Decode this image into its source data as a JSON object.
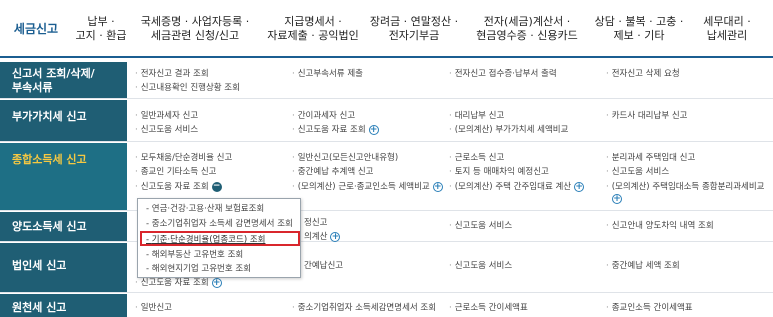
{
  "nav": {
    "tabs": [
      {
        "label": "세금신고",
        "active": true
      },
      {
        "label": "납부 ·\n고지 · 환급"
      },
      {
        "label": "국세증명 · 사업자등록 ·\n세금관련 신청/신고"
      },
      {
        "label": "지급명세서 ·\n자료제출 · 공익법인"
      },
      {
        "label": "장려금 · 연말정산 ·\n전자기부금"
      },
      {
        "label": "전자(세금)계산서 ·\n현금영수증 · 신용카드"
      },
      {
        "label": "상담 · 불복 · 고충 ·\n제보 · 기타"
      },
      {
        "label": "세무대리 ·\n납세관리"
      }
    ]
  },
  "rows": [
    {
      "category": "신고서 조회/삭제/\n부속서류",
      "links": [
        "전자신고 결과 조회",
        "신고부속서류 제출",
        "전자신고 접수증·납부서 출력",
        "전자신고 삭제 요청",
        "신고내용확인 진행상황 조회"
      ]
    },
    {
      "category": "부가가치세 신고",
      "links": [
        "일반과세자 신고",
        "간이과세자 신고",
        "대리납부 신고",
        "카드사 대리납부 신고",
        "신고도움 서비스",
        "신고도움 자료 조회",
        "(모의계산) 부가가치세 세액비교"
      ]
    },
    {
      "category": "종합소득세 신고",
      "links": [
        "모두채움/단순경비율 신고",
        "일반신고(모든신고안내유형)",
        "근로소득 신고",
        "분리과세 주택임대 신고",
        "종교인 기타소득 신고",
        "중간예납 추계액 신고",
        "토지 등 매매차익 예정신고",
        "신고도움 서비스",
        "신고도움 자료 조회",
        "(모의계산) 근로·종교인소득 세액비교",
        "(모의계산) 주택 간주임대료 계산",
        "(모의계산) 주택임대소득 종합분리과세비교"
      ]
    },
    {
      "category": "양도소득세 신고",
      "links": [
        "정신고",
        "의계산",
        "신고도움 서비스",
        "신고안내 양도차익 내역 조회"
      ]
    },
    {
      "category": "법인세 신고",
      "links": [
        "간예납신고",
        "신고도움 서비스",
        "중간예납 세액 조회",
        "신고도움 자료 조회"
      ]
    },
    {
      "category": "원천세 신고",
      "links": [
        "일반신고",
        "중소기업취업자 소득세감면명세서 조회",
        "근로소득 간이세액표",
        "종교인소득 간이세액표"
      ]
    }
  ],
  "popup": {
    "items": [
      "연금·건강·고용·산재 보험료조회",
      "중소기업취업자 소득세 감면명세서 조회",
      "기준·단순경비율(업종코드) 조회",
      "해외부동산 고유번호 조회",
      "해외현지기업 고유번호 조회"
    ]
  },
  "colors": {
    "category_bg": "#1f5e74",
    "active_category_text": "#f5c842",
    "accent": "#1b5e91",
    "highlight_box": "#d9262c"
  }
}
